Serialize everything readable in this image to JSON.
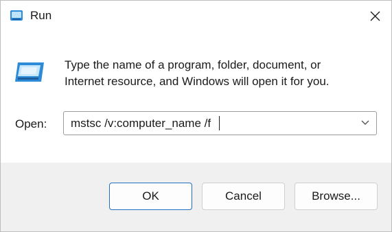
{
  "window": {
    "title": "Run",
    "close_icon": "close-icon",
    "app_icon": "run-icon"
  },
  "content": {
    "description_line1": "Type the name of a program, folder, document, or",
    "description_line2": "Internet resource, and Windows will open it for you.",
    "open_label": "Open:",
    "open_value": "mstsc /v:computer_name /f",
    "dropdown_icon": "chevron-down-icon"
  },
  "buttons": {
    "ok": "OK",
    "cancel": "Cancel",
    "browse": "Browse..."
  },
  "colors": {
    "accent": "#1f6fbf",
    "footer_bg": "#f0f0f0",
    "icon_blue": "#2e8bd8"
  }
}
